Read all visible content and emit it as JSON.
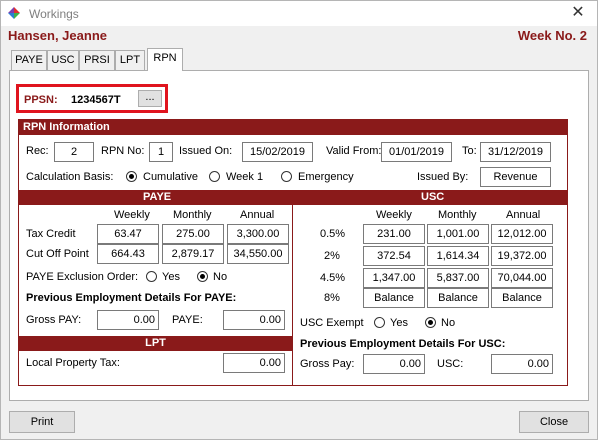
{
  "window": {
    "title": "Workings",
    "close_glyph": "✕"
  },
  "header": {
    "employee_name": "Hansen, Jeanne",
    "week": "Week No. 2"
  },
  "tabs": [
    {
      "label": "PAYE",
      "active": false
    },
    {
      "label": "USC",
      "active": false
    },
    {
      "label": "PRSI",
      "active": false
    },
    {
      "label": "LPT",
      "active": false
    },
    {
      "label": "RPN",
      "active": true
    }
  ],
  "ppsn": {
    "label": "PPSN:",
    "value": "1234567T",
    "lookup_label": "..."
  },
  "rpn": {
    "header": "RPN Information",
    "rec_label": "Rec:",
    "rec": "2",
    "rpn_no_label": "RPN No:",
    "rpn_no": "1",
    "issued_on_label": "Issued On:",
    "issued_on": "15/02/2019",
    "valid_from_label": "Valid From:",
    "valid_from": "01/01/2019",
    "to_label": "To:",
    "to": "31/12/2019",
    "calc_basis_label": "Calculation Basis:",
    "basis_options": [
      "Cumulative",
      "Week 1",
      "Emergency"
    ],
    "basis_selected": "Cumulative",
    "issued_by_label": "Issued By:",
    "issued_by": "Revenue"
  },
  "paye": {
    "header": "PAYE",
    "columns": [
      "Weekly",
      "Monthly",
      "Annual"
    ],
    "rows": [
      {
        "label": "Tax Credit",
        "values": [
          "63.47",
          "275.00",
          "3,300.00"
        ]
      },
      {
        "label": "Cut Off Point",
        "values": [
          "664.43",
          "2,879.17",
          "34,550.00"
        ]
      }
    ],
    "exclusion_label": "PAYE Exclusion Order:",
    "yes_label": "Yes",
    "no_label": "No",
    "exclusion_selected": "No",
    "prev_header": "Previous Employment Details For PAYE:",
    "gross_pay_label": "Gross PAY:",
    "gross_pay": "0.00",
    "paye_label": "PAYE:",
    "paye": "0.00"
  },
  "usc": {
    "header": "USC",
    "columns": [
      "Weekly",
      "Monthly",
      "Annual"
    ],
    "rows": [
      {
        "label": "0.5%",
        "values": [
          "231.00",
          "1,001.00",
          "12,012.00"
        ]
      },
      {
        "label": "2%",
        "values": [
          "372.54",
          "1,614.34",
          "19,372.00"
        ]
      },
      {
        "label": "4.5%",
        "values": [
          "1,347.00",
          "5,837.00",
          "70,044.00"
        ]
      },
      {
        "label": "8%",
        "values": [
          "Balance",
          "Balance",
          "Balance"
        ]
      }
    ],
    "exempt_label": "USC Exempt",
    "yes_label": "Yes",
    "no_label": "No",
    "exempt_selected": "No",
    "prev_header": "Previous Employment Details For USC:",
    "gross_pay_label": "Gross Pay:",
    "gross_pay": "0.00",
    "usc_label": "USC:",
    "usc": "0.00"
  },
  "lpt": {
    "header": "LPT",
    "label": "Local Property Tax:",
    "value": "0.00"
  },
  "footer": {
    "print_label": "Print",
    "close_label": "Close"
  },
  "colors": {
    "accent": "#8a1a1a",
    "highlight": "#e0141e"
  }
}
